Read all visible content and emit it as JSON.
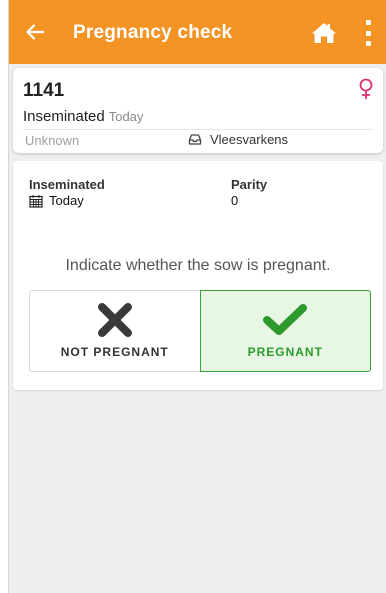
{
  "toolbar": {
    "title": "Pregnancy check",
    "back_icon": "arrow-left-icon",
    "home_icon": "home-icon",
    "menu_icon": "more-vertical-icon",
    "color": "#f39424"
  },
  "animal": {
    "id": "1141",
    "status": "Inseminated",
    "status_when": "Today",
    "breed": "Unknown",
    "location": "Vleesvarkens",
    "sex_icon": "female-icon",
    "sex_color": "#e0306a"
  },
  "details": {
    "inseminated_label": "Inseminated",
    "inseminated_value": "Today",
    "parity_label": "Parity",
    "parity_value": "0",
    "prompt": "Indicate whether the sow is pregnant."
  },
  "choices": {
    "not_pregnant_label": "NOT PREGNANT",
    "pregnant_label": "PREGNANT",
    "selected": "pregnant",
    "pregnant_color": "#2e9a2e"
  }
}
